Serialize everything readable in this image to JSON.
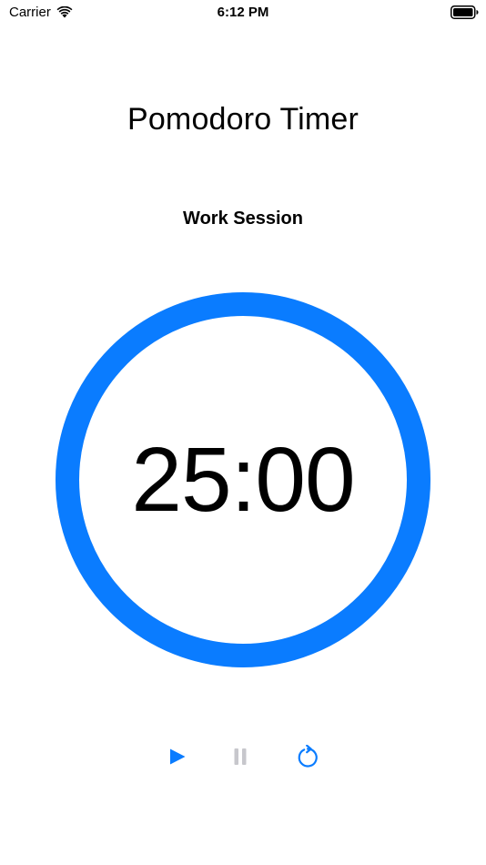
{
  "status_bar": {
    "carrier": "Carrier",
    "time": "6:12 PM",
    "icons": [
      "wifi-icon",
      "battery-icon"
    ]
  },
  "app": {
    "title": "Pomodoro Timer",
    "session_label": "Work Session",
    "time_remaining": "25:00",
    "progress": 1.0
  },
  "controls": {
    "play_icon": "play-icon",
    "pause_icon": "pause-icon",
    "reset_icon": "reset-icon",
    "pause_enabled": false
  },
  "colors": {
    "accent": "#0a7cff",
    "disabled": "#c7c7cc",
    "text": "#000000"
  }
}
